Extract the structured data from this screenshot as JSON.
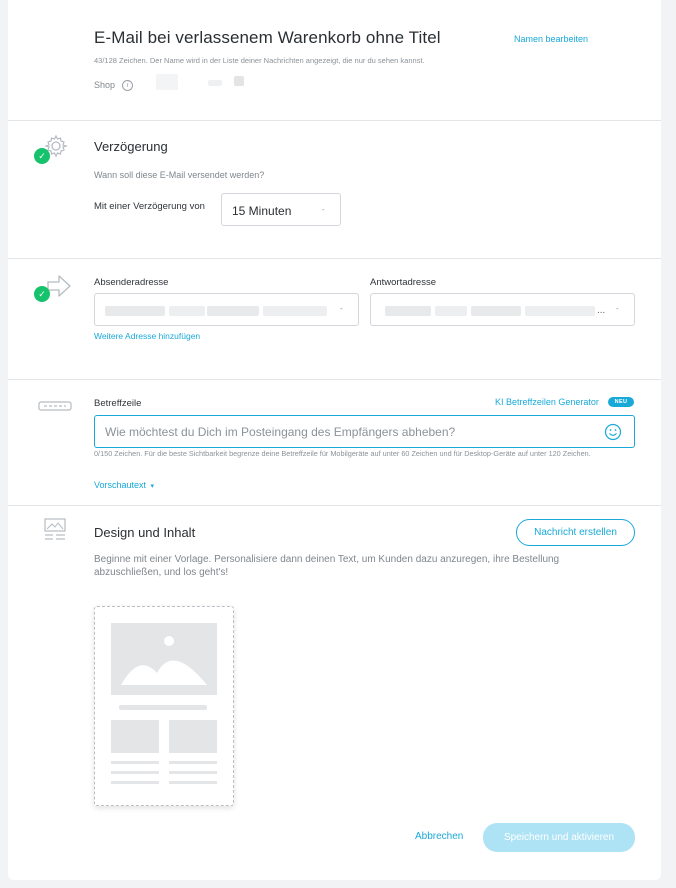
{
  "header": {
    "title": "E-Mail bei verlassenem Warenkorb ohne Titel",
    "rename_link": "Namen bearbeiten",
    "hint": "43/128 Zeichen. Der Name wird in der Liste deiner Nachrichten angezeigt, die nur du sehen kannst.",
    "shop_label": "Shop",
    "info_icon": "i"
  },
  "delay": {
    "heading": "Verzögerung",
    "question": "Wann soll diese E-Mail versendet werden?",
    "label": "Mit einer Verzögerung von",
    "selected": "15 Minuten",
    "caret": "-"
  },
  "sender": {
    "sender_label": "Absenderadresse",
    "reply_label": "Antwortadresse",
    "reply_ellipsis": "...",
    "caret": "-",
    "add_link": "Weitere Adresse hinzufügen"
  },
  "subject": {
    "label": "Betreffzeile",
    "ai_link": "KI Betreffzeilen Generator",
    "ai_badge": "NEU",
    "placeholder": "Wie möchtest du Dich im Posteingang des Empfängers abheben?",
    "hint": "0/150 Zeichen. Für die beste Sichtbarkeit begrenze deine Betreffzeile für Mobilgeräte auf unter 60 Zeichen und für Desktop-Geräte auf unter 120 Zeichen.",
    "preview_link": "Vorschautext",
    "preview_caret": "▾"
  },
  "design": {
    "heading": "Design und Inhalt",
    "create_button": "Nachricht erstellen",
    "description": "Beginne mit einer Vorlage. Personalisiere dann deinen Text, um Kunden dazu anzuregen, ihre Bestellung abzuschließen, und los geht's!"
  },
  "footer": {
    "cancel": "Abbrechen",
    "save": "Speichern und aktivieren"
  },
  "colors": {
    "accent": "#19a9d9",
    "success": "#17c26c",
    "disabled_button": "#aee3f5"
  },
  "icons": {
    "delay": "gear-icon",
    "sender": "arrow-right-icon",
    "subject": "subject-line-icon",
    "design": "layout-icon",
    "emoji": "smiley-icon",
    "check": "check-icon"
  }
}
